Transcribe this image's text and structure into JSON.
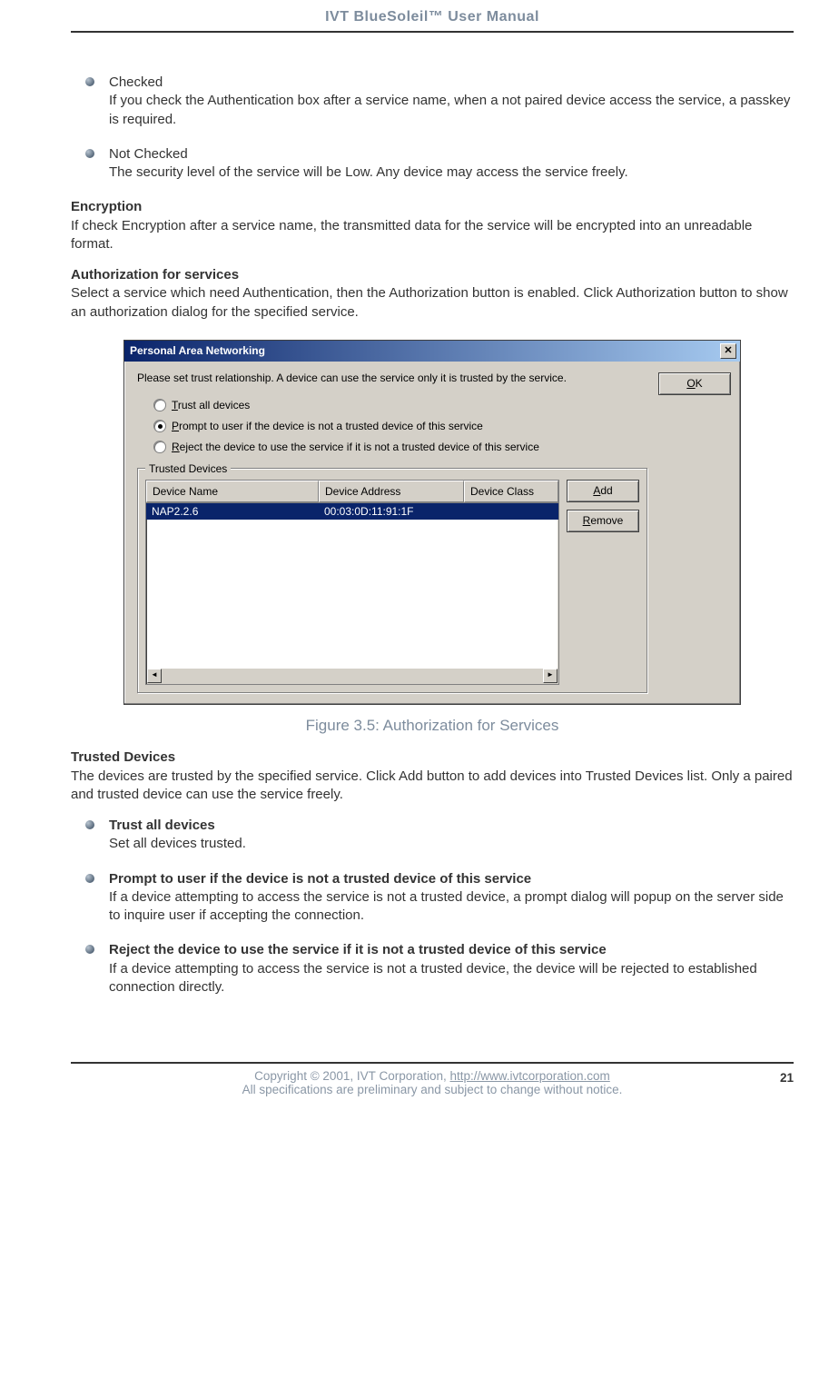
{
  "header": {
    "title": "IVT BlueSoleil™ User Manual"
  },
  "bullets_top": [
    {
      "title": "Checked",
      "body": "If you check the Authentication box after a service name, when a not paired device access the service, a passkey is required."
    },
    {
      "title": "Not Checked",
      "body": "The security level of the service will be Low. Any device may access the service freely."
    }
  ],
  "encryption": {
    "heading": "Encryption",
    "body": "If check Encryption after a service name, the transmitted data for the service will be encrypted into an unreadable format."
  },
  "authorization": {
    "heading": "Authorization for services",
    "body": "Select a service which need Authentication, then the Authorization button is enabled. Click Authorization button to show an authorization dialog for the specified service."
  },
  "dialog": {
    "title": "Personal Area Networking",
    "close_glyph": "✕",
    "instruction": "Please set trust relationship. A device can use the service only  it is trusted by the service.",
    "ok_label": "OK",
    "ok_underline": "O",
    "ok_rest": "K",
    "radios": [
      {
        "u": "T",
        "rest": "rust all devices",
        "checked": false
      },
      {
        "u": "P",
        "rest": "rompt to user if the device is not a trusted device of this service",
        "checked": true
      },
      {
        "u": "R",
        "rest": "eject the device to use the service if it is not a trusted device of this service",
        "checked": false
      }
    ],
    "groupbox_label": "Trusted Devices",
    "columns": [
      "Device Name",
      "Device Address",
      "Device Class"
    ],
    "row": {
      "name": "NAP2.2.6",
      "addr": "00:03:0D:11:91:1F",
      "cls": ""
    },
    "add_u": "A",
    "add_rest": "dd",
    "remove_u": "R",
    "remove_rest": "emove",
    "scroll_left": "◄",
    "scroll_right": "►"
  },
  "figure_caption": "Figure 3.5: Authorization for Services",
  "trusted_devices": {
    "heading": "Trusted Devices",
    "body": "The devices are trusted by the specified service. Click Add button to add devices into Trusted Devices list. Only a paired and trusted device can use the service freely."
  },
  "bullets_bottom": [
    {
      "title": "Trust all devices",
      "body": "Set all devices trusted."
    },
    {
      "title": "Prompt to user if the device is not a trusted device of this service",
      "body": "If a device attempting to access the service is not a trusted device, a prompt dialog will popup on the server side to inquire user if accepting the connection."
    },
    {
      "title": "Reject the device to use the service if it is not a trusted device of this service",
      "body": "If a device attempting to access the service is not a trusted device, the device will be rejected to established connection directly."
    }
  ],
  "footer": {
    "line1_pre": "Copyright © 2001, IVT Corporation, ",
    "link": "http://www.ivtcorporation.com",
    "line2": "All specifications are preliminary and subject to change without notice.",
    "page": "21"
  }
}
